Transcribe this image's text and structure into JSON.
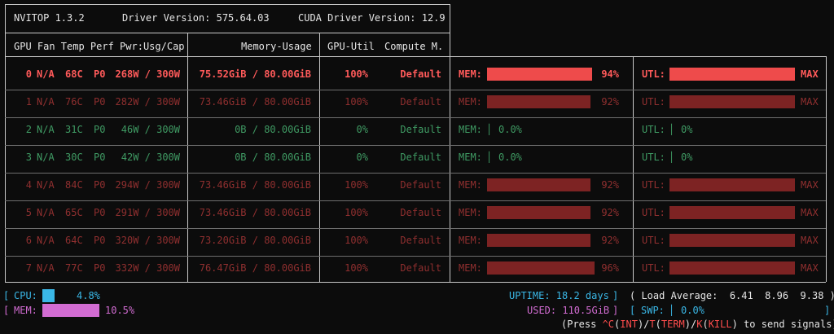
{
  "header": {
    "app": "NVITOP 1.3.2",
    "driver": "Driver Version: 575.64.03",
    "cuda": "CUDA Driver Version: 12.9"
  },
  "columns": {
    "left": "GPU Fan Temp Perf Pwr:Usg/Cap",
    "mem": "Memory-Usage",
    "util": "GPU-Util",
    "compute": "Compute M."
  },
  "gpus": [
    {
      "id": "0",
      "fan": "N/A",
      "temp": "68C",
      "perf": "P0",
      "pwr": "268W / 300W",
      "mem": "75.52GiB / 80.00GiB",
      "util": "100%",
      "compute": "Default",
      "mem_label": "MEM:",
      "mem_pct": "94%",
      "mem_frac": 0.94,
      "utl_label": "UTL:",
      "utl_pct": "MAX",
      "utl_frac": 1.0,
      "state": "highlight"
    },
    {
      "id": "1",
      "fan": "N/A",
      "temp": "76C",
      "perf": "P0",
      "pwr": "282W / 300W",
      "mem": "73.46GiB / 80.00GiB",
      "util": "100%",
      "compute": "Default",
      "mem_label": "MEM:",
      "mem_pct": "92%",
      "mem_frac": 0.92,
      "utl_label": "UTL:",
      "utl_pct": "MAX",
      "utl_frac": 1.0,
      "state": "busy"
    },
    {
      "id": "2",
      "fan": "N/A",
      "temp": "31C",
      "perf": "P0",
      "pwr": "46W / 300W",
      "mem": "0B / 80.00GiB",
      "util": "0%",
      "compute": "Default",
      "mem_label": "MEM:",
      "mem_pct": "0.0%",
      "mem_frac": 0.0,
      "utl_label": "UTL:",
      "utl_pct": "0%",
      "utl_frac": 0.0,
      "state": "idle"
    },
    {
      "id": "3",
      "fan": "N/A",
      "temp": "30C",
      "perf": "P0",
      "pwr": "42W / 300W",
      "mem": "0B / 80.00GiB",
      "util": "0%",
      "compute": "Default",
      "mem_label": "MEM:",
      "mem_pct": "0.0%",
      "mem_frac": 0.0,
      "utl_label": "UTL:",
      "utl_pct": "0%",
      "utl_frac": 0.0,
      "state": "idle"
    },
    {
      "id": "4",
      "fan": "N/A",
      "temp": "84C",
      "perf": "P0",
      "pwr": "294W / 300W",
      "mem": "73.46GiB / 80.00GiB",
      "util": "100%",
      "compute": "Default",
      "mem_label": "MEM:",
      "mem_pct": "92%",
      "mem_frac": 0.92,
      "utl_label": "UTL:",
      "utl_pct": "MAX",
      "utl_frac": 1.0,
      "state": "busy"
    },
    {
      "id": "5",
      "fan": "N/A",
      "temp": "65C",
      "perf": "P0",
      "pwr": "291W / 300W",
      "mem": "73.46GiB / 80.00GiB",
      "util": "100%",
      "compute": "Default",
      "mem_label": "MEM:",
      "mem_pct": "92%",
      "mem_frac": 0.92,
      "utl_label": "UTL:",
      "utl_pct": "MAX",
      "utl_frac": 1.0,
      "state": "busy"
    },
    {
      "id": "6",
      "fan": "N/A",
      "temp": "64C",
      "perf": "P0",
      "pwr": "320W / 300W",
      "mem": "73.20GiB / 80.00GiB",
      "util": "100%",
      "compute": "Default",
      "mem_label": "MEM:",
      "mem_pct": "92%",
      "mem_frac": 0.92,
      "utl_label": "UTL:",
      "utl_pct": "MAX",
      "utl_frac": 1.0,
      "state": "busy"
    },
    {
      "id": "7",
      "fan": "N/A",
      "temp": "77C",
      "perf": "P0",
      "pwr": "332W / 300W",
      "mem": "76.47GiB / 80.00GiB",
      "util": "100%",
      "compute": "Default",
      "mem_label": "MEM:",
      "mem_pct": "96%",
      "mem_frac": 0.96,
      "utl_label": "UTL:",
      "utl_pct": "MAX",
      "utl_frac": 1.0,
      "state": "busy"
    }
  ],
  "footer": {
    "cpu_label": "CPU:",
    "cpu_pct": "4.8%",
    "cpu_frac": 0.048,
    "mem_label": "MEM:",
    "mem_pct": "10.5%",
    "mem_frac": 0.105,
    "uptime": "UPTIME: 18.2 days",
    "load_avg": "( Load Average:  6.41  8.96  9.38 )",
    "used": "USED: 110.5GiB",
    "swp_label": "SWP:",
    "swp_pct": "0.0%",
    "press": "(Press ",
    "int_key": "^C",
    "int_label": "INT",
    "term_key": "T",
    "term_label": "TERM",
    "kill_key": "K",
    "kill_label": "KILL",
    "send": " to send signals)"
  },
  "colors": {
    "highlight": "#ff5a5a",
    "busy": "#8f2f2f",
    "idle": "#3f9a63",
    "bar_highlight": "#ee4b4b",
    "bar_busy": "#7d2323",
    "cyan": "#3ab7e6",
    "magenta": "#d26cd2"
  }
}
